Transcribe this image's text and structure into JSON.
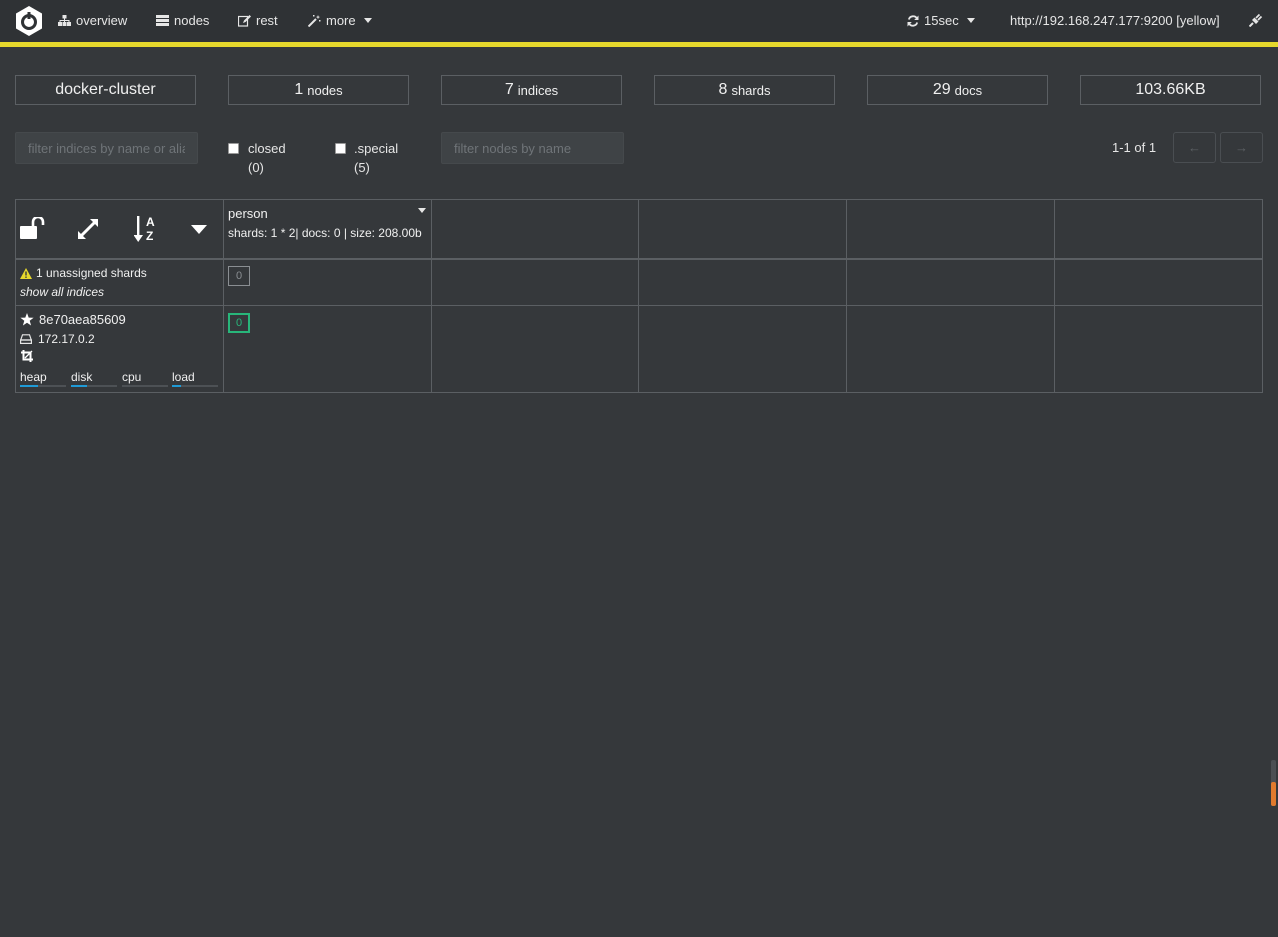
{
  "nav": {
    "overview": "overview",
    "nodes": "nodes",
    "rest": "rest",
    "more": "more",
    "refresh": "15sec",
    "connection": "http://192.168.247.177:9200 [yellow]"
  },
  "colors": {
    "accent_bar": "#e6d82c",
    "shard_started": "#28b67a",
    "metric_fill": "#1f9bd7",
    "warning": "#e6d82c"
  },
  "stats": {
    "cluster": "docker-cluster",
    "nodes_num": "1",
    "nodes_lbl": "nodes",
    "indices_num": "7",
    "indices_lbl": "indices",
    "shards_num": "8",
    "shards_lbl": "shards",
    "docs_num": "29",
    "docs_lbl": "docs",
    "size": "103.66KB"
  },
  "filters": {
    "indices_placeholder": "filter indices by name or aliases",
    "closed_label": "closed",
    "closed_count": "(0)",
    "special_label": ".special",
    "special_count": "(5)",
    "nodes_placeholder": "filter nodes by name",
    "pager": "1-1 of 1",
    "prev": "←",
    "next": "→"
  },
  "index": {
    "name": "person",
    "info": "shards: 1 * 2| docs: 0 | size: 208.00b"
  },
  "unassigned": {
    "text": "1 unassigned shards",
    "show_all": "show all indices",
    "shard": "0"
  },
  "node": {
    "name": "8e70aea85609",
    "ip": "172.17.0.2",
    "shard": "0",
    "metrics": [
      {
        "label": "heap",
        "level": 0.4
      },
      {
        "label": "disk",
        "level": 0.35
      },
      {
        "label": "cpu",
        "level": 0.0
      },
      {
        "label": "load",
        "level": 0.2
      }
    ]
  }
}
